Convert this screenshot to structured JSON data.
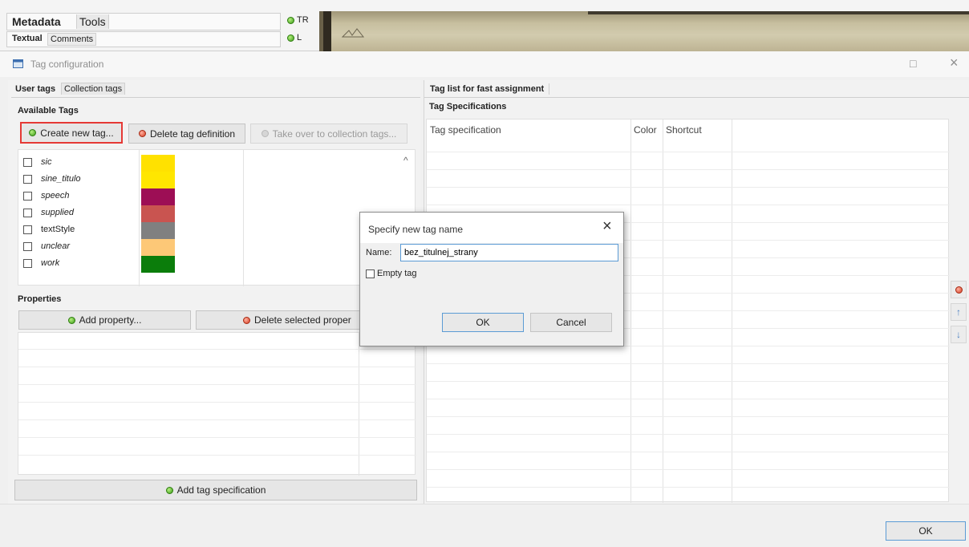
{
  "top_bar": {
    "tabs_row1": [
      "Metadata",
      "Tools"
    ],
    "tabs_row2": [
      "Textual",
      "Comments"
    ],
    "radio_labels": [
      "TR",
      "L"
    ]
  },
  "window": {
    "title": "Tag configuration",
    "maximize_symbol": "□",
    "close_symbol": "×"
  },
  "left_panel": {
    "tabs": [
      "User tags",
      "Collection tags"
    ],
    "available_tags_label": "Available Tags",
    "buttons": {
      "create": "Create new tag...",
      "delete": "Delete tag definition",
      "take_over": "Take over to collection tags..."
    },
    "scroll_up": "^",
    "tags": [
      {
        "name": "sic",
        "color": "#ffe100"
      },
      {
        "name": "sine_titulo",
        "color": "#ffe600"
      },
      {
        "name": "speech",
        "color": "#9d0e55"
      },
      {
        "name": "supplied",
        "color": "#c95450"
      },
      {
        "name": "textStyle",
        "color": "#808080"
      },
      {
        "name": "unclear",
        "color": "#fdc877"
      },
      {
        "name": "work",
        "color": "#0b7d0b"
      }
    ],
    "properties_label": "Properties",
    "add_property": "Add property...",
    "delete_property": "Delete selected proper",
    "add_tag_spec": "Add tag specification"
  },
  "right_panel": {
    "tab": "Tag list for fast assignment",
    "section_label": "Tag Specifications",
    "columns": [
      "Tag specification",
      "Color",
      "Shortcut"
    ],
    "side_arrows": [
      "↑",
      "↓"
    ]
  },
  "dialog": {
    "title": "Specify new tag name",
    "close_symbol": "×",
    "name_label": "Name:",
    "name_value": "bez_titulnej_strany",
    "empty_tag_label": "Empty tag",
    "ok": "OK",
    "cancel": "Cancel"
  },
  "footer": {
    "ok": "OK"
  },
  "colors": {
    "highlight_red": "#e53935",
    "focus_blue": "#5b9bd5"
  }
}
